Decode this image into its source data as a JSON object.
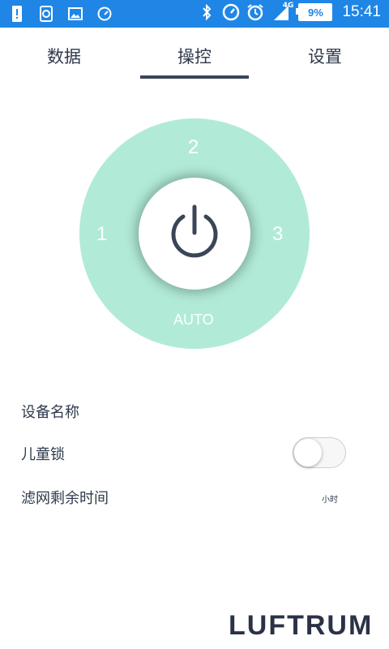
{
  "status_bar": {
    "time": "15:41",
    "battery": "9%",
    "network": "4G",
    "icons_left": [
      "alert-icon",
      "clipboard-icon",
      "image-icon",
      "speedometer-icon"
    ],
    "icons_right": [
      "bluetooth-icon",
      "speedometer-icon",
      "alarm-icon",
      "signal-icon",
      "battery-icon"
    ]
  },
  "tabs": [
    {
      "label": "数据",
      "selected": false
    },
    {
      "label": "操控",
      "selected": true
    },
    {
      "label": "设置",
      "selected": false
    }
  ],
  "control": {
    "speeds": {
      "top": "2",
      "left": "1",
      "right": "3",
      "bottom": "AUTO"
    },
    "power_icon": "power-icon",
    "wheel_color": "#b1ebd8"
  },
  "settings": {
    "device_name_label": "设备名称",
    "child_lock_label": "儿童锁",
    "child_lock_on": false,
    "filter_time_label": "滤网剩余时间",
    "filter_time_unit": "小时"
  },
  "brand": "LUFTRUM",
  "colors": {
    "status_bar": "#1f86e6",
    "accent": "#3a4558",
    "text": "#2f3a4c"
  }
}
